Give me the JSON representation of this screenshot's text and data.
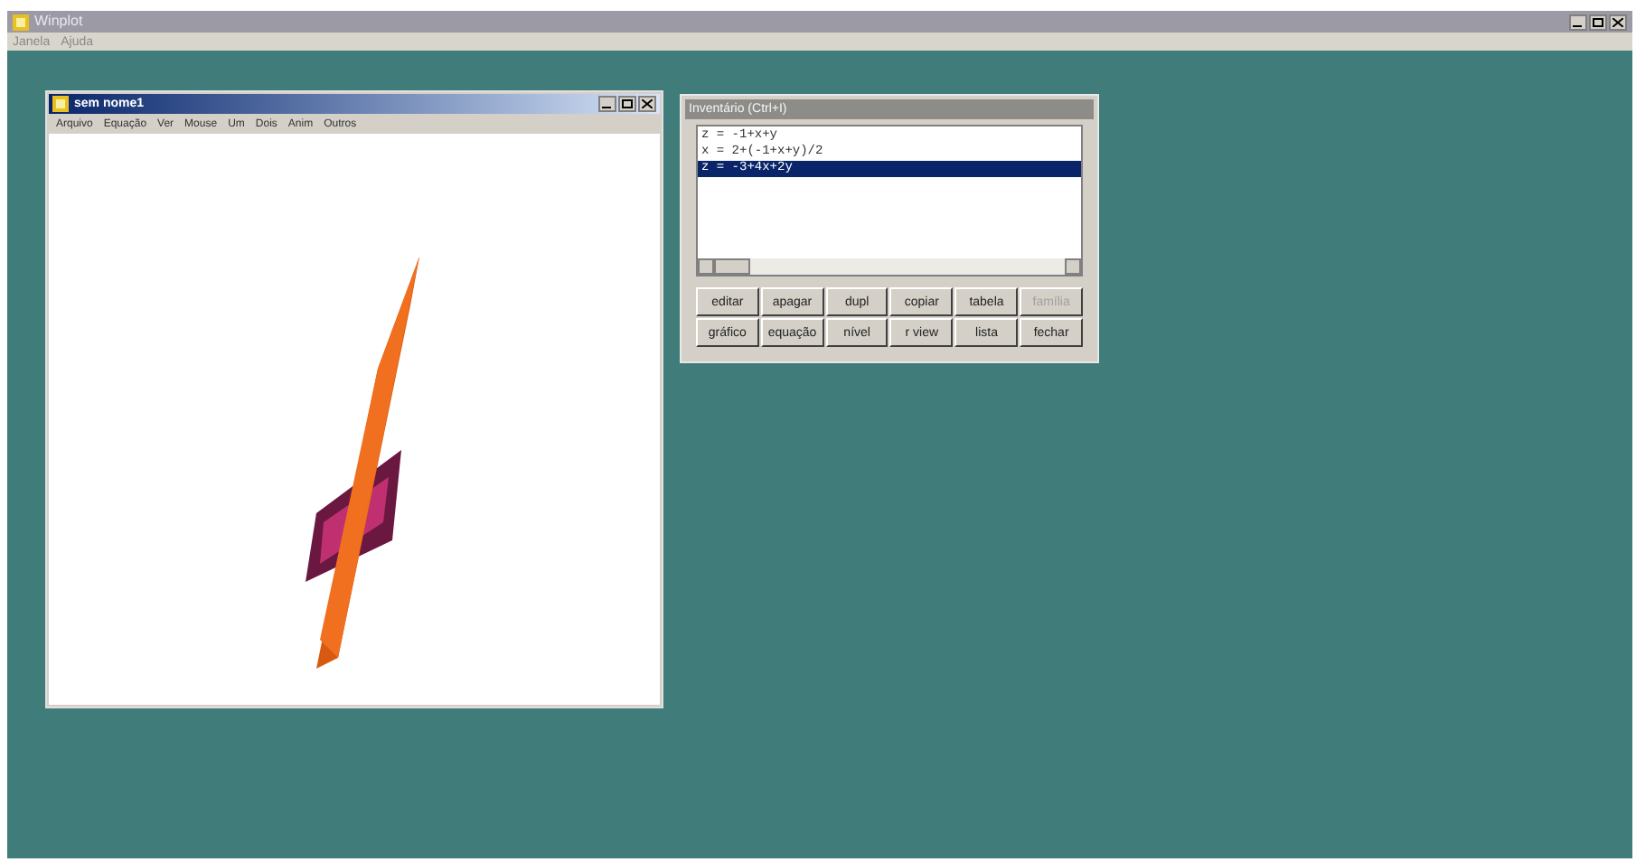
{
  "app": {
    "title": "Winplot",
    "menu": [
      "Janela",
      "Ajuda"
    ]
  },
  "graph_window": {
    "title": "sem nome1",
    "menu": [
      "Arquivo",
      "Equação",
      "Ver",
      "Mouse",
      "Um",
      "Dois",
      "Anim",
      "Outros"
    ]
  },
  "inventory": {
    "title": "Inventário (Ctrl+I)",
    "items": [
      {
        "text": "z = -1+x+y",
        "selected": false
      },
      {
        "text": "x = 2+(-1+x+y)/2",
        "selected": false
      },
      {
        "text": "z = -3+4x+2y",
        "selected": true
      }
    ],
    "buttons": [
      {
        "label": "editar",
        "disabled": false
      },
      {
        "label": "apagar",
        "disabled": false
      },
      {
        "label": "dupl",
        "disabled": false
      },
      {
        "label": "copiar",
        "disabled": false
      },
      {
        "label": "tabela",
        "disabled": false
      },
      {
        "label": "família",
        "disabled": true
      },
      {
        "label": "gráfico",
        "disabled": false
      },
      {
        "label": "equação",
        "disabled": false
      },
      {
        "label": "nível",
        "disabled": false
      },
      {
        "label": "r view",
        "disabled": false
      },
      {
        "label": "lista",
        "disabled": false
      },
      {
        "label": "fechar",
        "disabled": false
      }
    ]
  }
}
